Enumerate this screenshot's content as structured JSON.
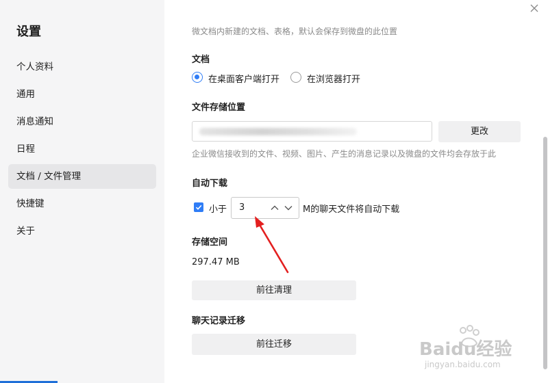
{
  "sidebar": {
    "title": "设置",
    "items": [
      {
        "label": "个人资料",
        "active": false
      },
      {
        "label": "通用",
        "active": false
      },
      {
        "label": "消息通知",
        "active": false
      },
      {
        "label": "日程",
        "active": false
      },
      {
        "label": "文档 / 文件管理",
        "active": true
      },
      {
        "label": "快捷键",
        "active": false
      },
      {
        "label": "关于",
        "active": false
      }
    ]
  },
  "main": {
    "intro_desc": "微文档内新建的文档、表格，默认会保存到微盘的此位置",
    "docs": {
      "title": "文档",
      "options": [
        {
          "label": "在桌面客户端打开",
          "checked": true
        },
        {
          "label": "在浏览器打开",
          "checked": false
        }
      ]
    },
    "storage_location": {
      "title": "文件存储位置",
      "change_label": "更改",
      "desc": "企业微信接收到的文件、视频、图片、产生的消息记录以及微盘的文件均会存放于此"
    },
    "auto_download": {
      "title": "自动下载",
      "checked": true,
      "prefix": "小于",
      "value": "3",
      "suffix": "M的聊天文件将自动下载"
    },
    "storage_space": {
      "title": "存储空间",
      "size": "297.47 MB",
      "clean_label": "前往清理"
    },
    "migration": {
      "title": "聊天记录迁移",
      "migrate_label": "前往迁移"
    }
  },
  "watermark": {
    "brand": "Baidu经验",
    "url": "jingyan.baidu.com"
  },
  "colors": {
    "accent": "#2f7df6",
    "annotation_arrow": "#e32020"
  }
}
